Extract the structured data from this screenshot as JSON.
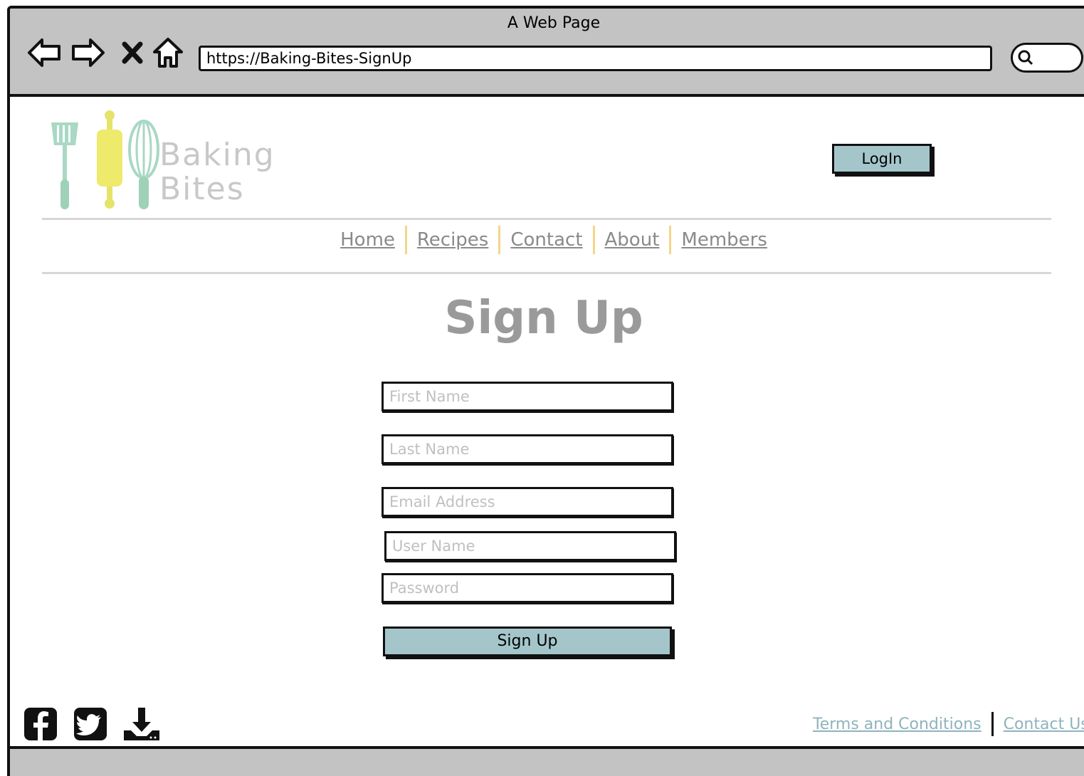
{
  "browser": {
    "window_title": "A Web Page",
    "url": "https://Baking-Bites-SignUp"
  },
  "logo": {
    "line1": "Baking",
    "line2": "Bites"
  },
  "header": {
    "login_label": "LogIn"
  },
  "nav": {
    "items": [
      "Home",
      "Recipes",
      "Contact",
      "About",
      "Members"
    ]
  },
  "form": {
    "title": "Sign Up",
    "fields": {
      "first_name": "First Name",
      "last_name": "Last Name",
      "email": "Email Address",
      "username": "User Name",
      "password": "Password"
    },
    "submit_label": "Sign Up"
  },
  "footer": {
    "links": [
      "Terms and Conditions",
      "Contact Us"
    ],
    "social_icons": [
      "facebook-icon",
      "twitter-icon",
      "download-icon"
    ]
  },
  "colors": {
    "chrome": "#c3c3c3",
    "button": "#a4c6cb",
    "nav_separator": "#f3d68a",
    "footer_link": "#8fb3bd",
    "heading": "#9a9a9a"
  }
}
